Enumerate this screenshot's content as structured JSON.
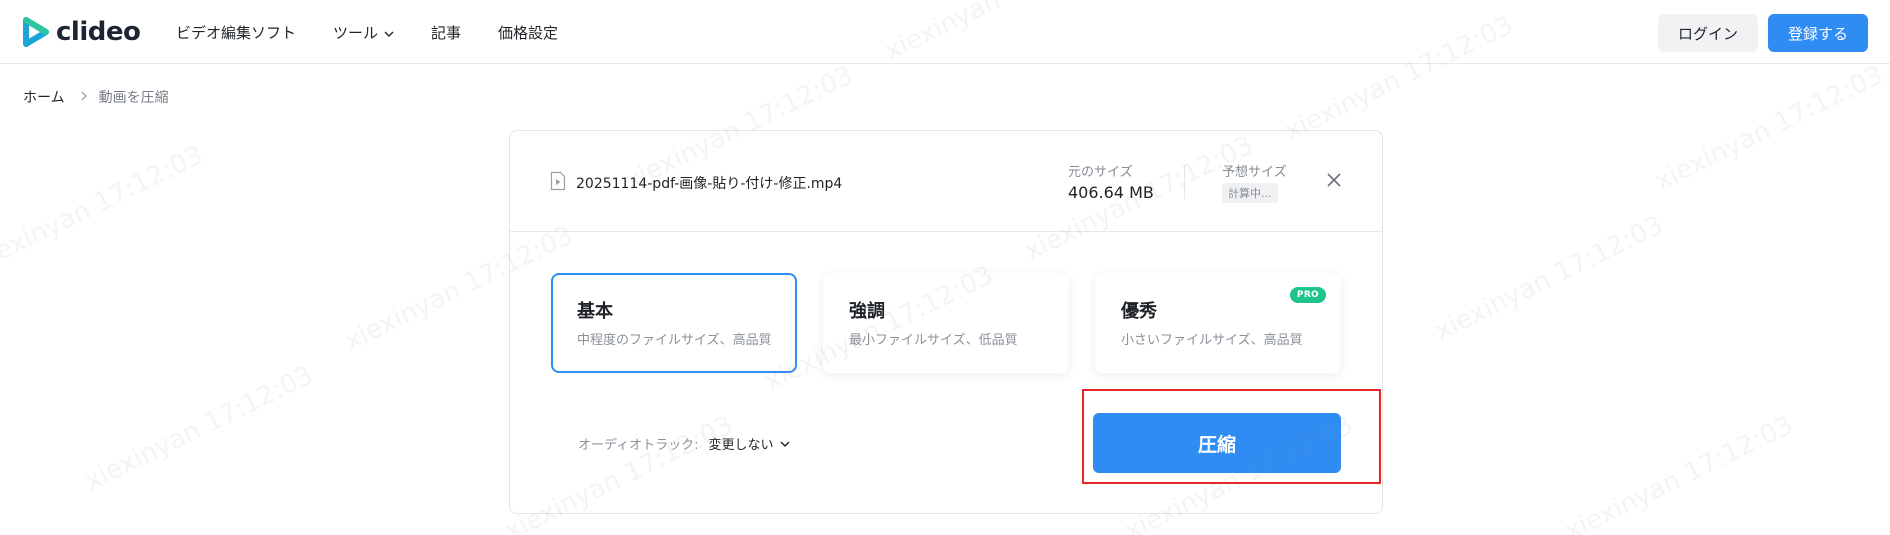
{
  "header": {
    "logo_text": "clideo",
    "nav": [
      {
        "label": "ビデオ編集ソフト",
        "has_dropdown": false
      },
      {
        "label": "ツール",
        "has_dropdown": true
      },
      {
        "label": "記事",
        "has_dropdown": false
      },
      {
        "label": "価格設定",
        "has_dropdown": false
      }
    ],
    "login_label": "ログイン",
    "register_label": "登録する"
  },
  "breadcrumb": {
    "home": "ホーム",
    "current": "動画を圧縮"
  },
  "file": {
    "name": "20251114-pdf-画像-貼り-付け-修正.mp4",
    "original_size_label": "元のサイズ",
    "original_size_value": "406.64 MB",
    "estimated_size_label": "予想サイズ",
    "estimated_size_value": "計算中..."
  },
  "options": [
    {
      "title": "基本",
      "description": "中程度のファイルサイズ、高品質",
      "selected": true,
      "pro": false
    },
    {
      "title": "強調",
      "description": "最小ファイルサイズ、低品質",
      "selected": false,
      "pro": false
    },
    {
      "title": "優秀",
      "description": "小さいファイルサイズ、高品質",
      "selected": false,
      "pro": true
    }
  ],
  "pro_badge": "PRO",
  "audio": {
    "label": "オーディオトラック:",
    "value": "変更しない"
  },
  "compress_label": "圧縮",
  "watermark": {
    "text": "xiexinyan 17:12:03"
  },
  "colors": {
    "accent": "#2f8cf3",
    "pro": "#1fc48b",
    "highlight": "#e32626"
  }
}
